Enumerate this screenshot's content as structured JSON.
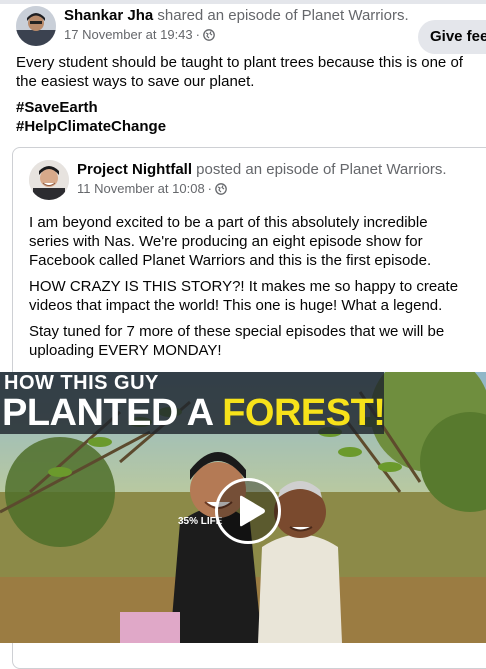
{
  "post": {
    "author": "Shankar Jha",
    "action": " shared an episode of Planet Warriors.",
    "timestamp": "17 November at 19:43",
    "separator": " · ",
    "privacy_icon": "globe-icon",
    "text": "Every student should be taught to plant trees because this is one of the easiest ways to save our planet.",
    "hashtags": [
      "#SaveEarth",
      "#HelpClimateChange"
    ]
  },
  "feedback_button": {
    "label": "Give fee"
  },
  "shared_post": {
    "author": "Project Nightfall",
    "action": " posted an episode of Planet Warriors.",
    "timestamp": "11 November at 10:08",
    "separator": " · ",
    "privacy_icon": "globe-icon",
    "paragraphs": [
      "I am beyond excited to be a part of this absolutely incredible series with Nas. We're producing an eight episode show for Facebook called Planet Warriors and this is the first episode.",
      "HOW CRAZY IS THIS STORY?! It makes me so happy to create videos that impact the world! This one is huge! What a legend.",
      "Stay tuned for 7 more of these special episodes that we will be uploading EVERY MONDAY!"
    ]
  },
  "video": {
    "title_line1": "HOW THIS GUY",
    "title_line2_part1": "PLANTED A ",
    "title_line2_highlight": "FOREST!",
    "shirt_text": "35%  LIFE",
    "play_icon": "play-icon",
    "highlight_color": "#f7e21a"
  }
}
